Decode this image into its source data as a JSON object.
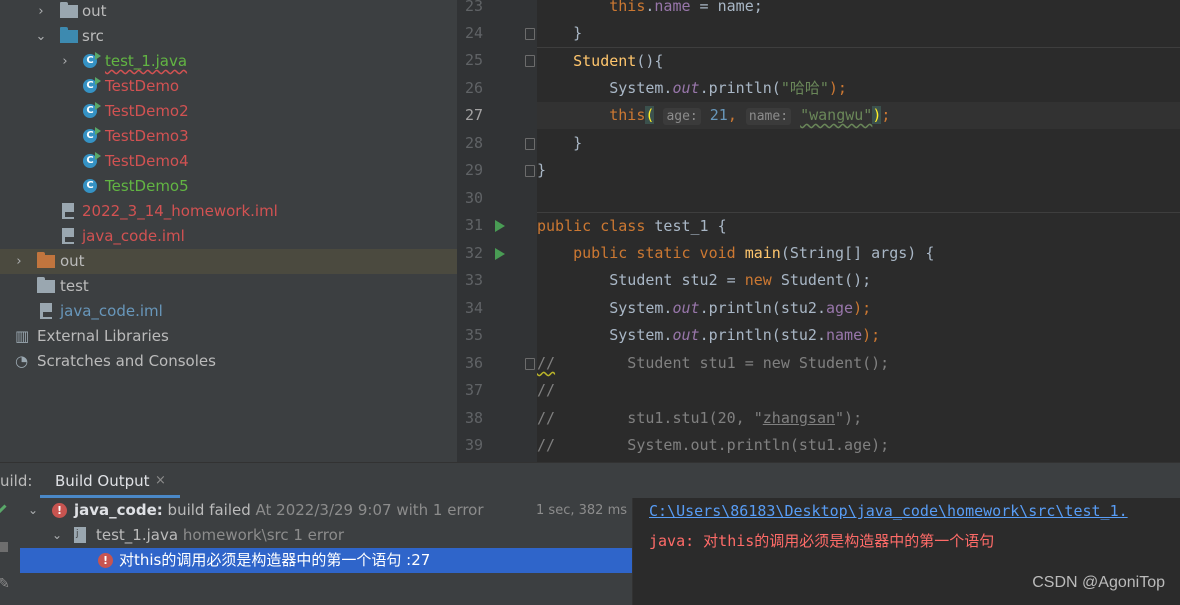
{
  "project_tree": {
    "items": [
      {
        "label": "out",
        "type": "folder",
        "chevron": "right",
        "color": "#9aa7b0",
        "text_class": ""
      },
      {
        "label": "src",
        "type": "folder",
        "chevron": "down",
        "color": "#3d8ab0",
        "text_class": ""
      },
      {
        "label": "test_1.java",
        "type": "class-run",
        "chevron": "right",
        "text_class": "green green-under"
      },
      {
        "label": "TestDemo",
        "type": "class-run",
        "chevron": "",
        "text_class": "red"
      },
      {
        "label": "TestDemo2",
        "type": "class-run",
        "chevron": "",
        "text_class": "red"
      },
      {
        "label": "TestDemo3",
        "type": "class-run",
        "chevron": "",
        "text_class": "red"
      },
      {
        "label": "TestDemo4",
        "type": "class-run",
        "chevron": "",
        "text_class": "red"
      },
      {
        "label": "TestDemo5",
        "type": "class",
        "chevron": "",
        "text_class": "green"
      },
      {
        "label": "2022_3_14_homework.iml",
        "type": "iml",
        "chevron": "",
        "text_class": "red"
      },
      {
        "label": "java_code.iml",
        "type": "iml",
        "chevron": "",
        "text_class": "red"
      },
      {
        "label": "out",
        "type": "folder",
        "chevron": "right",
        "color": "#c1753e",
        "text_class": "",
        "selected": true
      },
      {
        "label": "test",
        "type": "folder",
        "chevron": "",
        "color": "#9aa7b0",
        "text_class": ""
      },
      {
        "label": "java_code.iml",
        "type": "iml",
        "chevron": "",
        "text_class": "blue"
      },
      {
        "label": "External Libraries",
        "type": "libs",
        "chevron": "",
        "text_class": ""
      },
      {
        "label": "Scratches and Consoles",
        "type": "scratch",
        "chevron": "",
        "text_class": ""
      }
    ]
  },
  "editor": {
    "line_numbers": [
      "23",
      "24",
      "25",
      "26",
      "27",
      "28",
      "29",
      "30",
      "31",
      "32",
      "33",
      "34",
      "35",
      "36",
      "37",
      "38",
      "39"
    ],
    "current_line": "27",
    "run_lines": [
      "31",
      "32"
    ],
    "hint_age": "age:",
    "hint_name": "name:",
    "lines_text": {
      "l23_this": "this",
      "l23_field": "name",
      "l23_rest": " = name;",
      "l24": "}",
      "l25_fn": "Student",
      "l25_rest": "(){",
      "l26_a": "System.",
      "l26_out": "out",
      "l26_b": ".println(",
      "l26_str": "\"哈哈\"",
      "l26_c": ");",
      "l27_this": "this",
      "l27_open": "(",
      "l27_num": "21",
      "l27_comma": ",",
      "l27_str": "\"wangwu\"",
      "l27_close": ")",
      "l27_semi": ";",
      "l28": "}",
      "l29": "}",
      "l31_kw": "public class ",
      "l31_rest": "test_1 {",
      "l32_kw": "public static void ",
      "l32_fn": "main",
      "l32_rest": "(String[] args) {",
      "l33_a": "Student stu2 = ",
      "l33_kw": "new ",
      "l33_b": "Student();",
      "l34_a": "System.",
      "l34_out": "out",
      "l34_b": ".println(stu2.",
      "l34_fld": "age",
      "l34_c": ");",
      "l35_a": "System.",
      "l35_out": "out",
      "l35_b": ".println(stu2.",
      "l35_fld": "name",
      "l35_c": ");",
      "l36_slash": "//",
      "l36_rest": "        Student stu1 = new Student();",
      "l37": "//",
      "l38_a": "//        stu1.stu1(20, \"",
      "l38_b": "zhangsan",
      "l38_c": "\");",
      "l39": "//        System.out.println(stu1.age);"
    }
  },
  "build_panel": {
    "prefix": "uild:",
    "tab_label": "Build Output",
    "tab_close": "×",
    "rows": {
      "root_bold": "java_code:",
      "root_text": " build failed",
      "root_gray": " At 2022/3/29 9:07 with 1 error",
      "root_time": "1 sec, 382 ms",
      "file_name": "test_1.java",
      "file_gray": " homework\\src 1 error",
      "error_text": "对this的调用必须是构造器中的第一个语句 :27"
    },
    "console": {
      "path": "C:\\Users\\86183\\Desktop\\java_code\\homework\\src\\test_1.",
      "message": "java: 对this的调用必须是构造器中的第一个语句",
      "watermark": "CSDN @AgoniTop"
    }
  }
}
